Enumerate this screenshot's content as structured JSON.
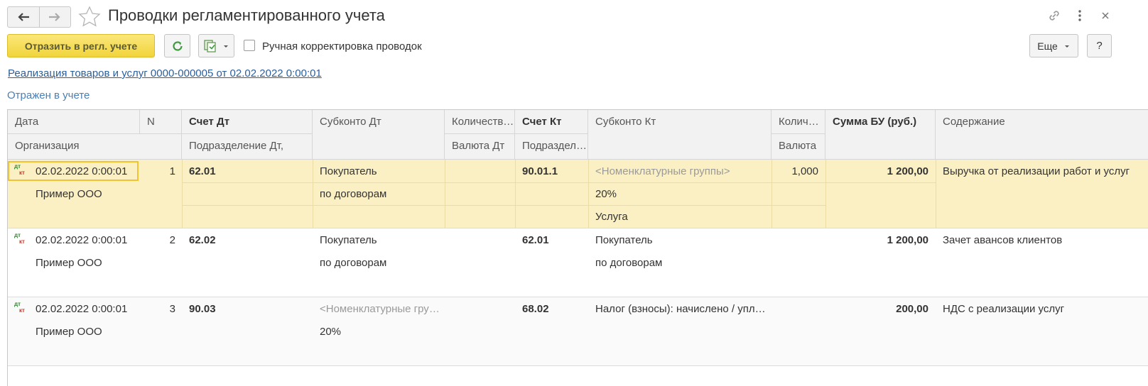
{
  "window": {
    "title": "Проводки регламентированного учета"
  },
  "toolbar": {
    "post_label": "Отразить в регл. учете",
    "manual_label": "Ручная корректировка проводок",
    "more_label": "Еще",
    "help_label": "?"
  },
  "document_link": "Реализация товаров и услуг 0000-000005 от 02.02.2022 0:00:01",
  "status_text": "Отражен в учете",
  "table": {
    "headers": {
      "date": "Дата",
      "n": "N",
      "acc_dt": "Счет Дт",
      "sub_dt": "Субконто Дт",
      "qty_dt": "Количество Дт",
      "acc_kt": "Счет Кт",
      "sub_kt": "Субконто Кт",
      "qty_kt": "Количество Кт",
      "sum": "Сумма БУ (руб.)",
      "content": "Содержание",
      "org": "Организация",
      "dep_dt": "Подразделение Дт,",
      "cur_dt": "Валюта Дт",
      "dep_kt": "Подразделение Кт",
      "cur_kt": "Валюта"
    },
    "rows": [
      {
        "date": "02.02.2022 0:00:01",
        "org": "Пример ООО",
        "n": "1",
        "acc_dt": "62.01",
        "sub_dt": [
          "Покупатель",
          "по договорам"
        ],
        "acc_kt": "90.01.1",
        "sub_kt": [
          "<Номенклатурные группы>",
          "20%",
          "Услуга"
        ],
        "qty_kt": "1,000",
        "sum": "1 200,00",
        "content": "Выручка от реализации работ и услуг"
      },
      {
        "date": "02.02.2022 0:00:01",
        "org": "Пример ООО",
        "n": "2",
        "acc_dt": "62.02",
        "sub_dt": [
          "Покупатель",
          "по договорам"
        ],
        "acc_kt": "62.01",
        "sub_kt": [
          "Покупатель",
          "по договорам"
        ],
        "sum": "1 200,00",
        "content": "Зачет авансов клиентов"
      },
      {
        "date": "02.02.2022 0:00:01",
        "org": "Пример ООО",
        "n": "3",
        "acc_dt": "90.03",
        "sub_dt": [
          "<Номенклатурные группы>",
          "20%"
        ],
        "acc_kt": "68.02",
        "sub_kt": [
          "Налог (взносы): начислено / уплачено"
        ],
        "sum": "200,00",
        "content": "НДС с реализации услуг"
      }
    ]
  },
  "icons": {
    "dt_label": "дт",
    "kt_label": "кт"
  },
  "colors": {
    "accent_yellow": "#f1d43b",
    "selected_row": "#fbf0c4",
    "link": "#2a5f9c",
    "refresh_green": "#3c9a3c"
  }
}
